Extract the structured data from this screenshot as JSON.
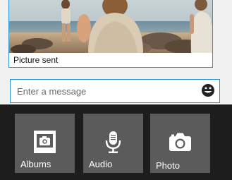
{
  "message": {
    "caption": "Picture sent",
    "image_subject": "beach-photo-of-people"
  },
  "composer": {
    "placeholder": "Enter a message",
    "emoji_icon": "smiley-icon"
  },
  "attachments": {
    "albums_label": "Albums",
    "audio_label": "Audio",
    "photo_label": "Photo"
  },
  "colors": {
    "accent": "#2a98d0",
    "panel_background": "#1d1d1d",
    "tile_background": "#5b5b5b",
    "page_background": "#f1f1f1"
  }
}
